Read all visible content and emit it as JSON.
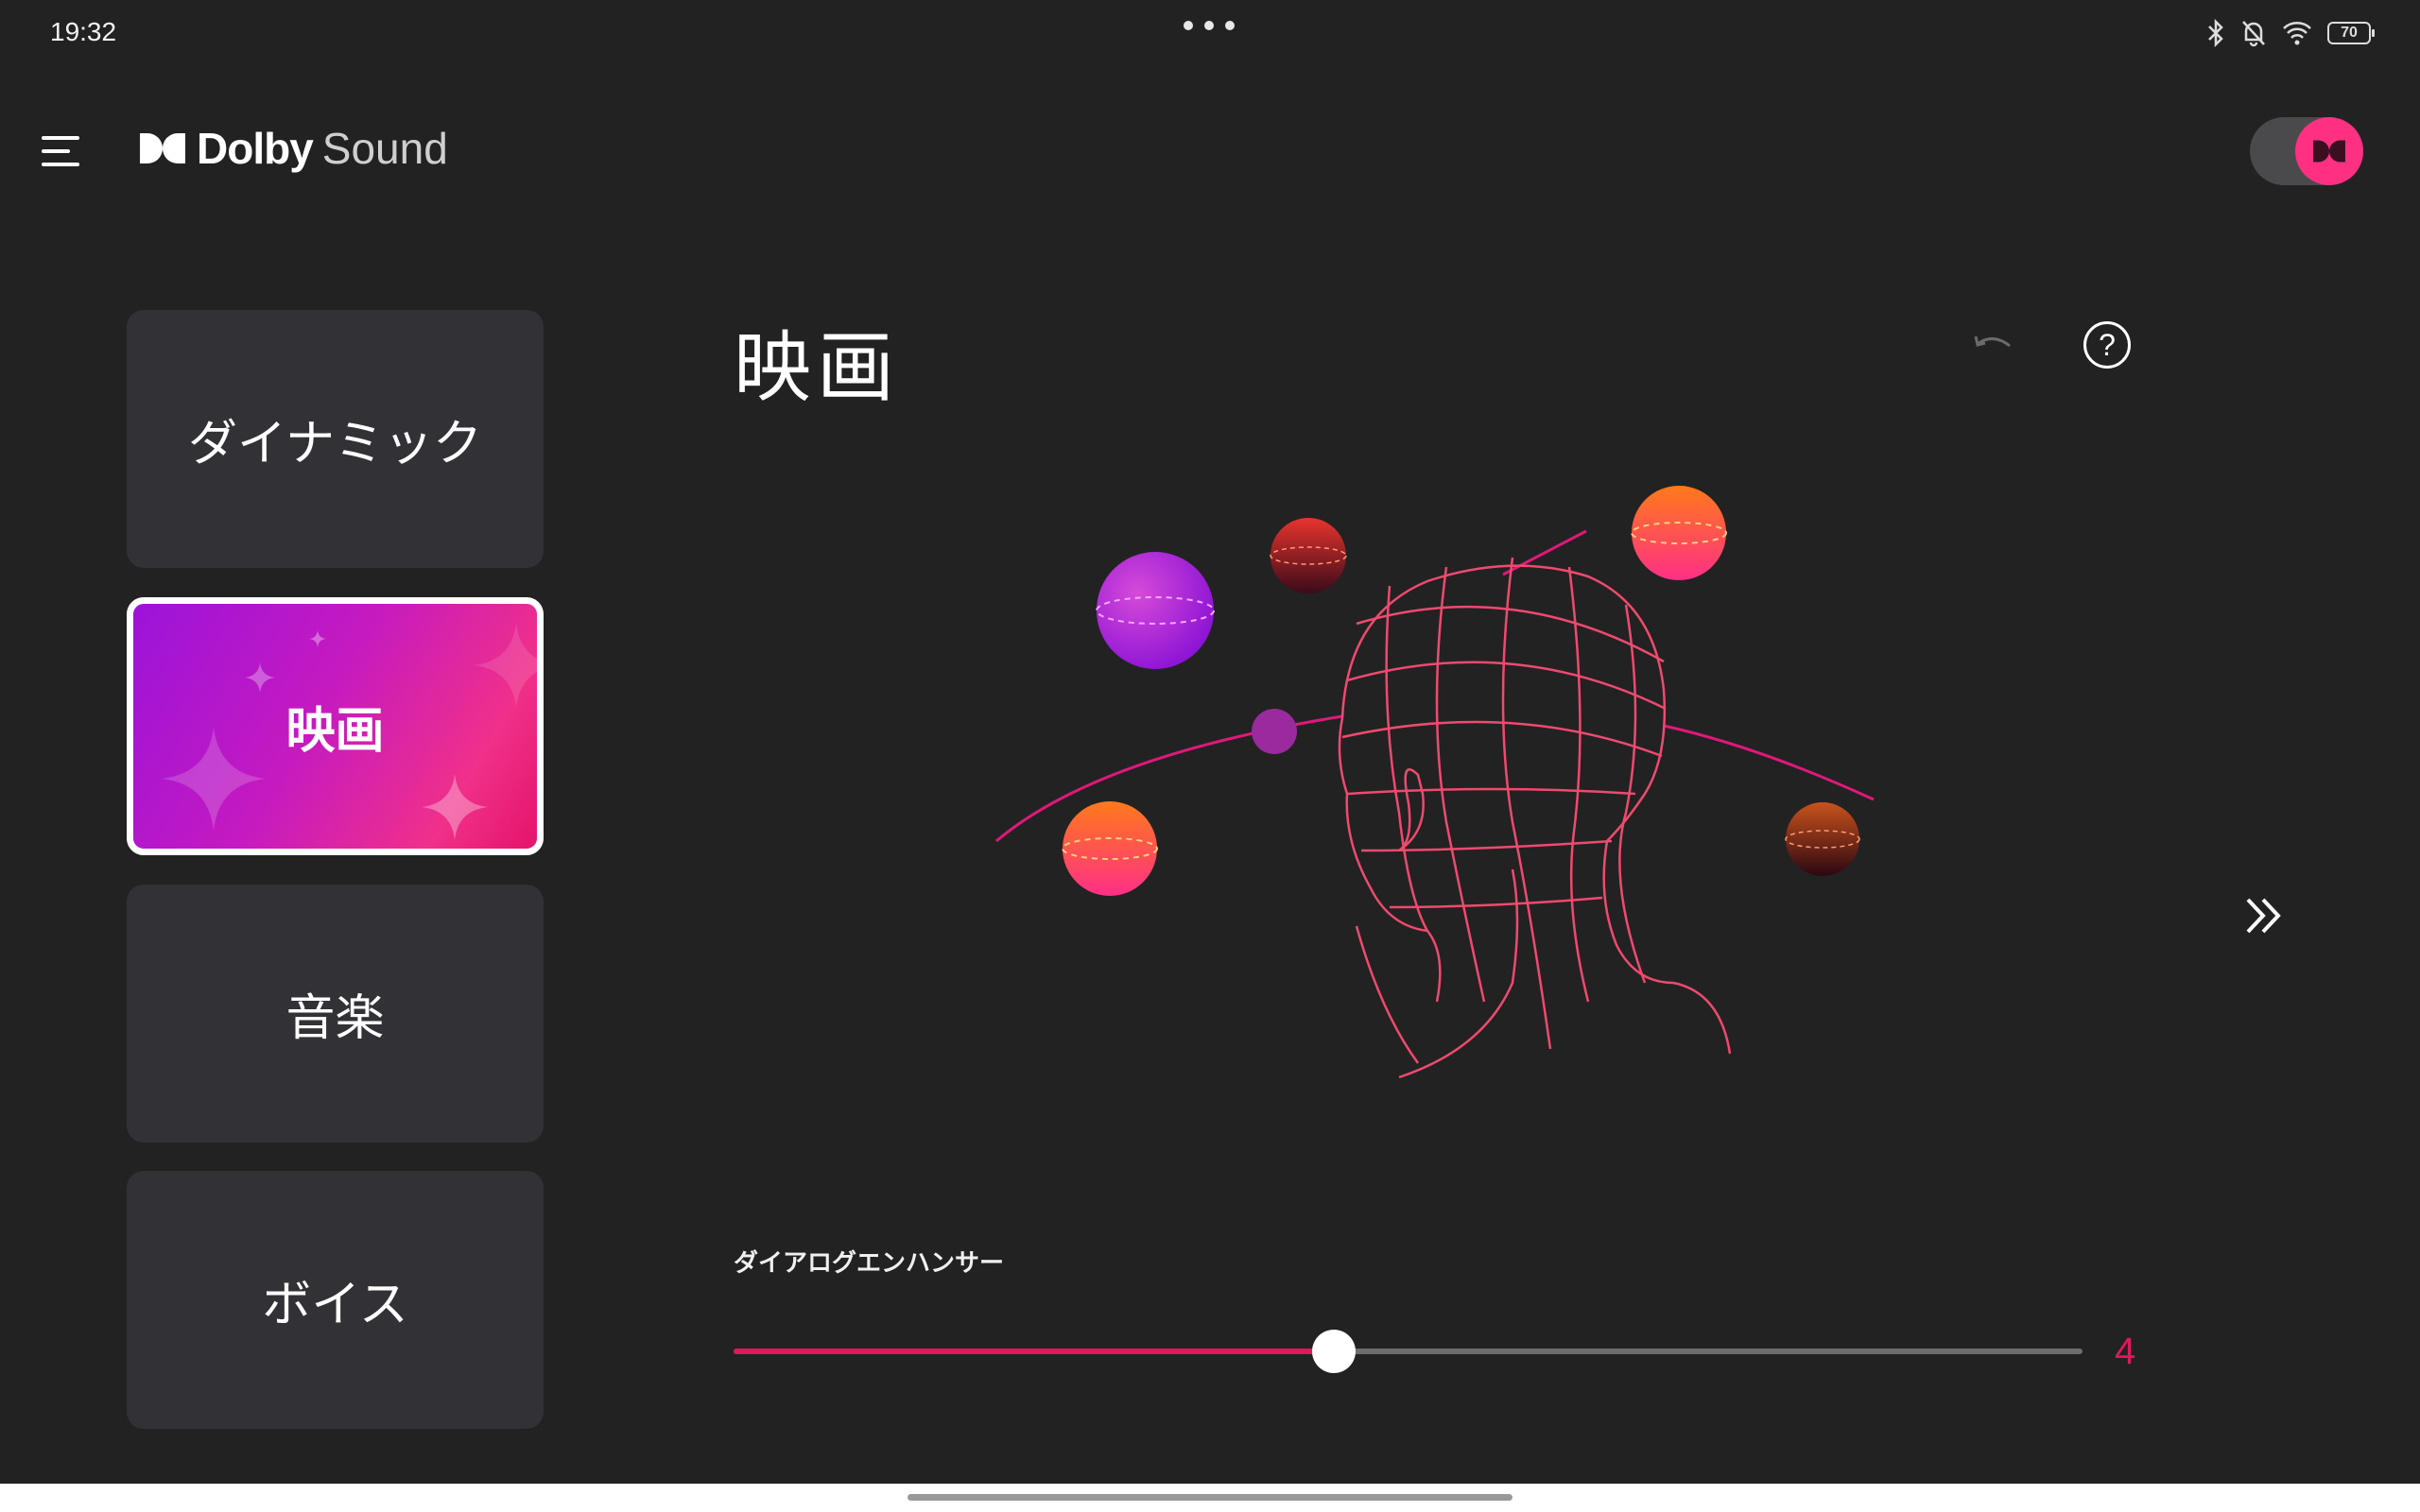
{
  "status_bar": {
    "time": "19:32",
    "battery": "70",
    "icons": [
      "bluetooth-icon",
      "bell-off-icon",
      "wifi-icon",
      "battery-icon"
    ]
  },
  "app_bar": {
    "brand_name": "Dolby",
    "brand_sub": "Sound",
    "master_toggle": "on"
  },
  "profiles": [
    {
      "label": "ダイナミック",
      "selected": false
    },
    {
      "label": "映画",
      "selected": true
    },
    {
      "label": "音楽",
      "selected": false
    },
    {
      "label": "ボイス",
      "selected": false
    }
  ],
  "main": {
    "title": "映画",
    "help_symbol": "?",
    "dialogue_enhancer": {
      "label": "ダイアログエンハンサー",
      "value": "4",
      "level": 0.445
    }
  },
  "colors": {
    "background": "#222223",
    "card": "#323236",
    "accent": "#e0185a",
    "toggle": "#ff2f82"
  }
}
